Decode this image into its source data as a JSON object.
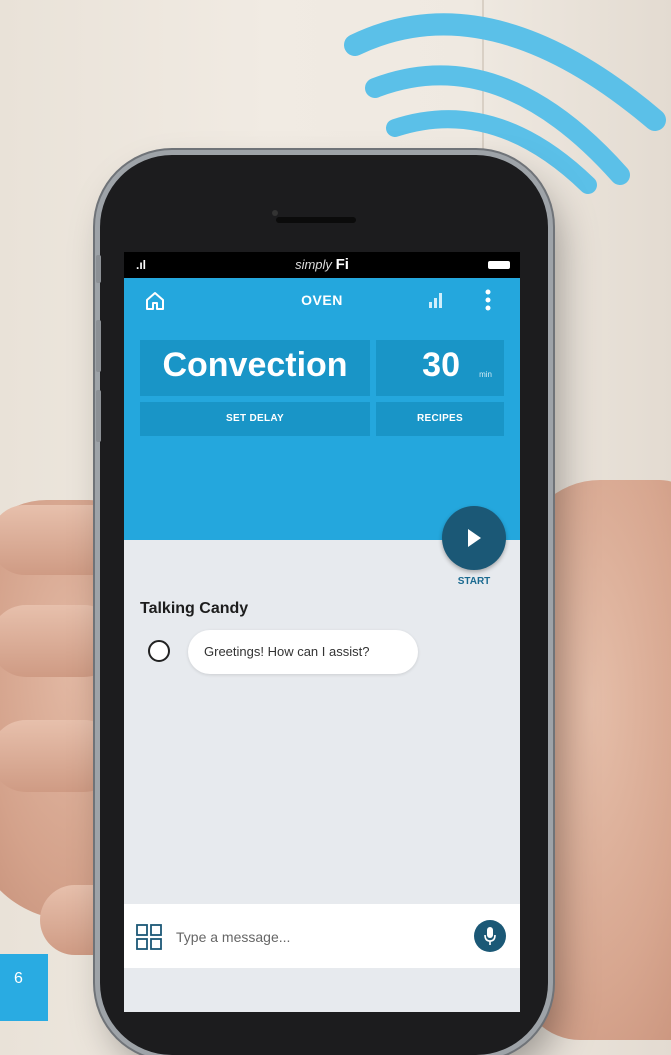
{
  "status_bar": {
    "brand_prefix": "simply",
    "brand_suffix": "Fi"
  },
  "header": {
    "title": "OVEN"
  },
  "cooking": {
    "mode": "Convection",
    "time_value": "30",
    "time_unit": "min",
    "set_delay_label": "SET DELAY",
    "recipes_label": "RECIPES",
    "start_label": "START"
  },
  "chat": {
    "assistant_name": "Talking Candy",
    "messages": [
      {
        "text": "Greetings! How can I assist?"
      }
    ]
  },
  "input": {
    "placeholder": "Type a message..."
  },
  "page_number": "6",
  "colors": {
    "app_blue": "#24a7dd",
    "tile_blue": "#1995c7",
    "dark_button": "#1b5876",
    "wifi_arc": "#5bc0e8",
    "page_badge": "#29abe2"
  },
  "icons": [
    "home-icon",
    "signal-bars-icon",
    "kebab-menu-icon",
    "play-icon",
    "bot-icon",
    "grid-icon",
    "microphone-icon",
    "wifi-icon"
  ]
}
